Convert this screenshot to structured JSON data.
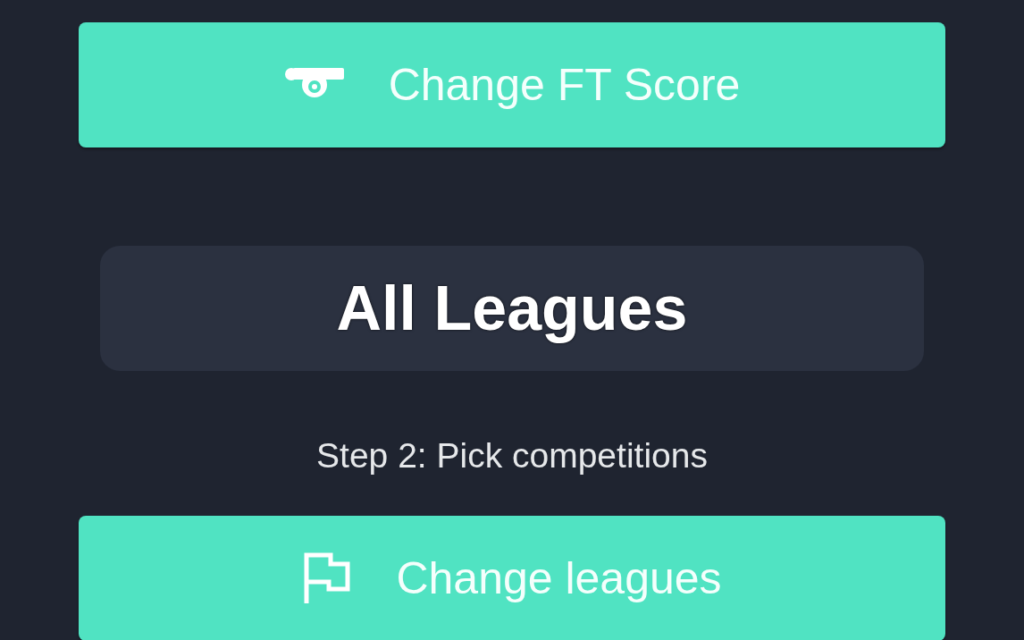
{
  "ft_score_button": {
    "label": "Change FT Score"
  },
  "league_panel": {
    "title": "All Leagues"
  },
  "step_label": "Step 2: Pick competitions",
  "leagues_button": {
    "label": "Change leagues"
  }
}
